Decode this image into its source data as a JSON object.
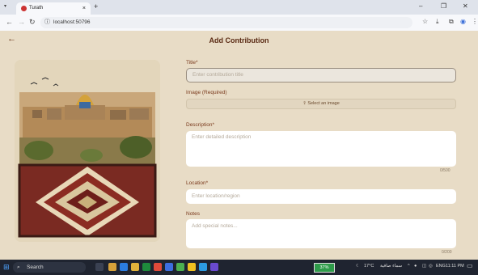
{
  "browser": {
    "tab_title": "Turath",
    "tab_close": "×",
    "new_tab": "+",
    "tab_dropdown": "▾",
    "url": "localhost:50796",
    "window_controls": [
      "–",
      "❐",
      "✕"
    ]
  },
  "app": {
    "title": "Add Contribution",
    "back_icon": "←",
    "title_label": "Title*",
    "title_placeholder": "Enter contribution title",
    "image_label": "Image (Required)",
    "image_button": "⇪ Select an image",
    "description_label": "Description*",
    "description_placeholder": "Enter detailed description",
    "description_count": "0/500",
    "location_label": "Location*",
    "location_placeholder": "Enter location/region",
    "notes_label": "Notes",
    "notes_placeholder": "Add special notes...",
    "notes_count": "0/200"
  },
  "taskbar": {
    "search": "Search",
    "battery": "37%",
    "weather": "17°C",
    "weather_desc": "سماء صافية",
    "lang": "ENG",
    "time": "11:11 PM"
  },
  "colors": {
    "background": "#e8dcc6",
    "accent": "#7a3a1d",
    "taskbar": "#1f2430"
  }
}
